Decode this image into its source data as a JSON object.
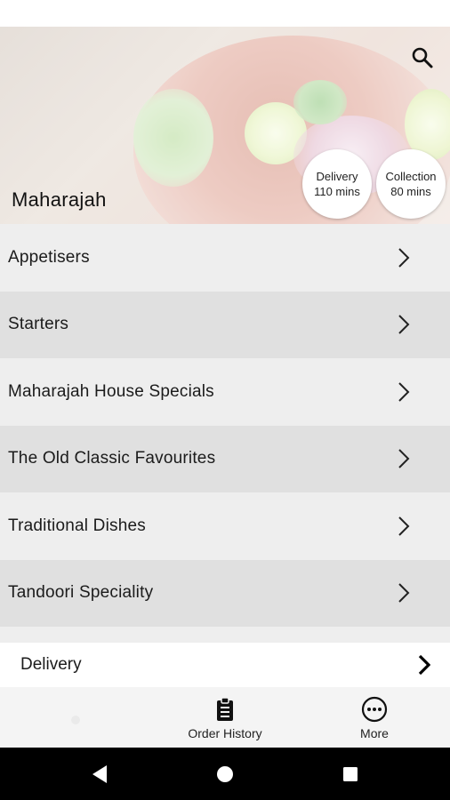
{
  "restaurant": {
    "name": "Maharajah"
  },
  "badges": {
    "delivery": {
      "label": "Delivery",
      "time": "110 mins"
    },
    "collection": {
      "label": "Collection",
      "time": "80 mins"
    }
  },
  "categories": [
    {
      "label": "Appetisers"
    },
    {
      "label": "Starters"
    },
    {
      "label": "Maharajah House Specials"
    },
    {
      "label": "The Old Classic Favourites"
    },
    {
      "label": "Traditional Dishes"
    },
    {
      "label": "Tandoori Speciality"
    }
  ],
  "order_mode": {
    "label": "Delivery"
  },
  "tabs": {
    "history": {
      "label": "Order History",
      "icon": "clipboard-icon"
    },
    "more": {
      "label": "More",
      "icon": "more-dots-icon"
    }
  },
  "icons": {
    "search": "search-icon",
    "chevron": "chevron-right-icon",
    "nav_back": "back-triangle-icon",
    "nav_home": "home-circle-icon",
    "nav_recent": "recent-square-icon"
  },
  "colors": {
    "row_light": "#eeeeee",
    "row_dark": "#e0e0e0",
    "tabbar": "#f4f4f4",
    "navbar": "#000000"
  }
}
